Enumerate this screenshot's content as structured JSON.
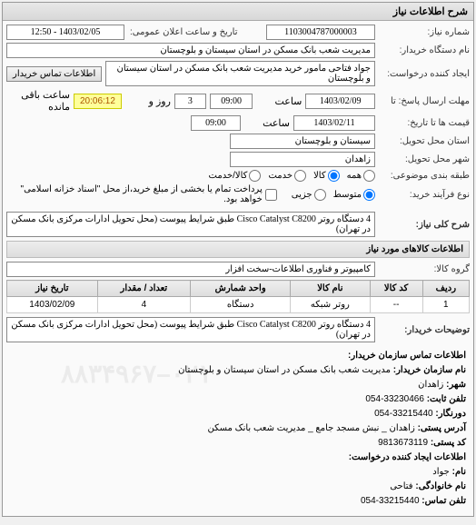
{
  "panel_main_title": "شرح اطلاعات نیاز",
  "req_number_label": "شماره نیاز:",
  "req_number": "1103004787000003",
  "announce_label": "تاریخ و ساعت اعلان عمومی:",
  "announce_value": "1403/02/05 - 12:50",
  "buyer_org_label": "نام دستگاه خریدار:",
  "buyer_org": "مدیریت شعب بانک مسکن در استان سیستان و بلوچستان",
  "requester_label": "ایجاد کننده درخواست:",
  "requester": "جواد  فتاحی مامور خرید مدیریت شعب بانک مسکن در استان سیستان و بلوچستان",
  "buyer_contact_btn": "اطلاعات تماس خریدار",
  "deadline_from_label": "مهلت ارسال پاسخ: تا",
  "deadline_date": "1403/02/09",
  "deadline_time_label": "ساعت",
  "deadline_time": "09:00",
  "days_label": "روز و",
  "days_value": "3",
  "remain_label": "ساعت باقی مانده",
  "remain_timer": "20:06:12",
  "price_until_label": "قیمت ها تا تاریخ:",
  "price_date": "1403/02/11",
  "price_time": "09:00",
  "deliver_province_label": "استان محل تحویل:",
  "deliver_province": "سیستان و بلوچستان",
  "deliver_city_label": "شهر محل تحویل:",
  "deliver_city": "زاهدان",
  "subject_label": "طبقه بندی موضوعی:",
  "radio_all": "همه",
  "radio_goods": "کالا",
  "radio_service": "خدمت",
  "radio_both": "کالا/خدمت",
  "contract_label": "نوع فرآیند خرید:",
  "radio_medium": "متوسط",
  "radio_small": "جزیی",
  "payment_note": "پرداخت تمام یا بخشی از مبلغ خرید،از محل \"اسناد خزانه اسلامی\" خواهد بود.",
  "need_desc_label": "شرح کلی نیاز:",
  "need_desc": "4 دستگاه روتر Cisco Catalyst C8200 طبق شرایط پیوست (محل تحویل ادارات مرکزی بانک مسکن در تهران)",
  "goods_info_title": "اطلاعات کالاهای مورد نیاز",
  "goods_group_label": "گروه کالا:",
  "goods_group": "کامپیوتر و فناوری اطلاعات-سخت افزار",
  "table": {
    "headers": [
      "ردیف",
      "کد کالا",
      "نام کالا",
      "واحد شمارش",
      "تعداد / مقدار",
      "تاریخ نیاز"
    ],
    "row": [
      "1",
      "--",
      "روتر شبکه",
      "دستگاه",
      "4",
      "1403/02/09"
    ]
  },
  "buyer_notes_label": "توضیحات خریدار:",
  "buyer_notes": "4 دستگاه روتر Cisco Catalyst C8200 طبق شرایط پیوست (محل تحویل ادارات مرکزی بانک مسکن در تهران)",
  "contact_title": "اطلاعات تماس سازمان خریدار:",
  "org_name_label": "نام سازمان خریدار:",
  "org_name": "مدیریت شعب بانک مسکن در استان سیستان و بلوچستان",
  "city_label": "شهر:",
  "city": "زاهدان",
  "phone_label": "تلفن ثابت:",
  "phone": "33230466-054",
  "fax_label": "دورنگار:",
  "fax": "33215440-054",
  "address_label": "آدرس پستی:",
  "address": "زاهدان _ نبش مسجد جامع _ مدیریت شعب بانک مسکن",
  "postal_label": "کد پستی:",
  "postal": "9813673119",
  "requester_info_title": "اطلاعات ایجاد کننده درخواست:",
  "fname_label": "نام:",
  "fname": "جواد",
  "lname_label": "نام خانوادگی:",
  "lname": "فتاحی",
  "rphone_label": "تلفن تماس:",
  "rphone": "33215440-054",
  "watermark": "۰۲۱–۸۸۳۴۹۶۷"
}
